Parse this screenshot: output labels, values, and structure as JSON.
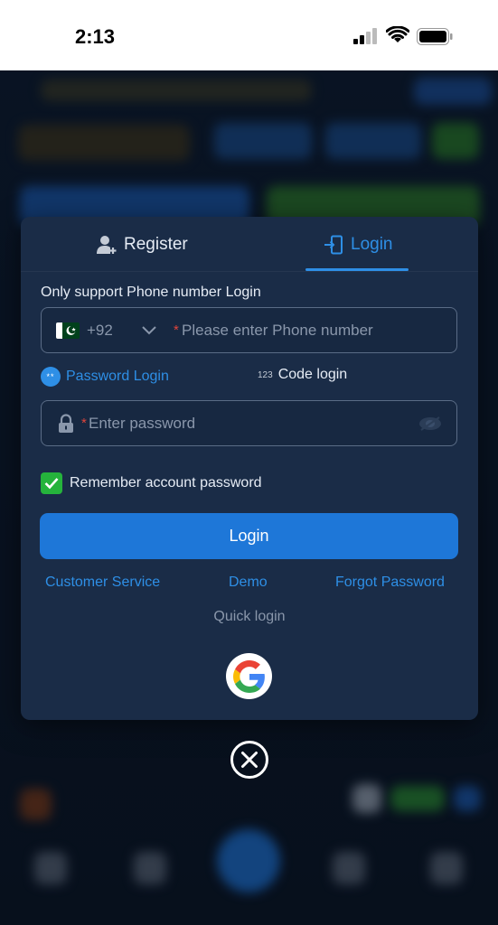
{
  "status_bar": {
    "time": "2:13"
  },
  "modal": {
    "tabs": [
      {
        "label": "Register",
        "icon": "add-user-icon",
        "active": false
      },
      {
        "label": "Login",
        "icon": "login-door-icon",
        "active": true
      }
    ],
    "support_text": "Only support Phone number Login",
    "phone": {
      "country_code": "+92",
      "required_mark": "*",
      "placeholder": "Please enter Phone number",
      "value": ""
    },
    "modes": {
      "password_label": "Password Login",
      "password_icon_text": "**",
      "code_label": "Code login",
      "code_icon_text": "123"
    },
    "password": {
      "required_mark": "*",
      "placeholder": "Enter password",
      "value": ""
    },
    "remember": {
      "label": "Remember account password",
      "checked": true
    },
    "login_button": "Login",
    "links": {
      "customer_service": "Customer Service",
      "demo": "Demo",
      "forgot": "Forgot Password"
    },
    "quick_login": "Quick login",
    "social": [
      "google-icon"
    ]
  },
  "colors": {
    "accent": "#2e8fe6",
    "button": "#1e77d8",
    "checkbox": "#25b33c",
    "modal_bg": "#1a2c47",
    "required": "#e0453c"
  }
}
